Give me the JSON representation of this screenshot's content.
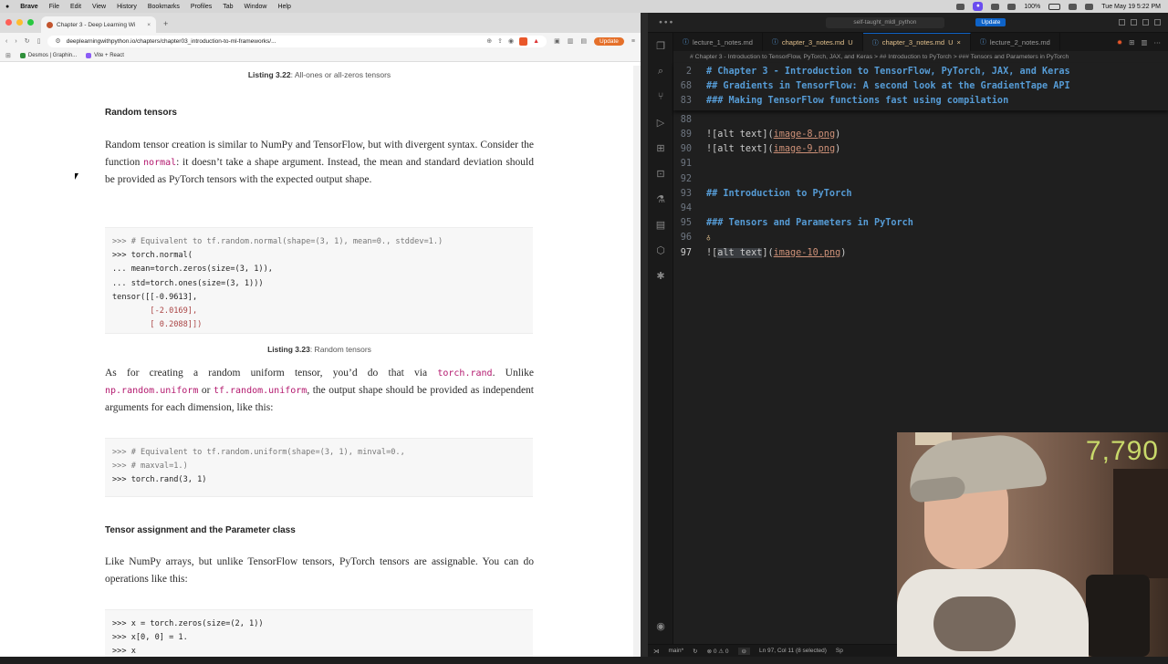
{
  "menubar": {
    "items": [
      "Brave",
      "File",
      "Edit",
      "View",
      "History",
      "Bookmarks",
      "Profiles",
      "Tab",
      "Window",
      "Help"
    ],
    "zoom": "100%",
    "datetime": "Tue May 19  5:22 PM"
  },
  "browser": {
    "tab_title": "Chapter 3 - Deep Learning Wi",
    "url": "deeplearningwithpython.io/chapters/chapter03_introduction-to-ml-frameworks/...",
    "update_label": "Update",
    "bookmarks": [
      "Desmos | Graphin...",
      "Vite + React"
    ],
    "page": {
      "caption_322": "Listing 3.22",
      "caption_322_text": ": All-ones or all-zeros tensors",
      "h_random": "Random tensors",
      "p1_a": "Random tensor creation is similar to NumPy and TensorFlow, but with divergent syntax. Consider the function ",
      "p1_code": "normal",
      "p1_b": ": it doesn’t take a shape argument. Instead, the mean and standard deviation should be provided as PyTorch tensors with the expected output shape.",
      "code1": [
        ">>> # Equivalent to tf.random.normal(shape=(3, 1), mean=0., stddev=1.)",
        ">>> torch.normal(",
        "... mean=torch.zeros(size=(3, 1)),",
        "... std=torch.ones(size=(3, 1)))",
        "tensor([[-0.9613],",
        "        [-2.0169],",
        "        [ 0.2088]])"
      ],
      "caption_323": "Listing 3.23",
      "caption_323_text": ": Random tensors",
      "p2_a": "As for creating a random uniform tensor, you’d do that via ",
      "p2_code1": "torch.rand",
      "p2_b": ". Unlike ",
      "p2_code2": "np.random.uniform",
      "p2_c": " or ",
      "p2_code3": "tf.random.uniform",
      "p2_d": ", the output shape should be provided as independent arguments for each dimension, like this:",
      "code2": [
        ">>> # Equivalent to tf.random.uniform(shape=(3, 1), minval=0.,",
        ">>> # maxval=1.)",
        ">>> torch.rand(3, 1)"
      ],
      "h_assign": "Tensor assignment and the Parameter class",
      "p3": "Like NumPy arrays, but unlike TensorFlow tensors, PyTorch tensors are assignable. You can do operations like this:",
      "code3": [
        ">>> x = torch.zeros(size=(2, 1))",
        ">>> x[0, 0] = 1.",
        ">>> x"
      ]
    }
  },
  "editor": {
    "workspace": "self-taught_mldl_python",
    "update_label": "Update",
    "tabs": [
      {
        "label": "lecture_1_notes.md",
        "mod": ""
      },
      {
        "label": "chapter_3_notes.md",
        "mod": "U"
      },
      {
        "label": "chapter_3_notes.md",
        "mod": "U"
      },
      {
        "label": "lecture_2_notes.md",
        "mod": ""
      }
    ],
    "breadcrumbs": "# Chapter 3 - Introduction to TensorFlow, PyTorch, JAX, and Keras  >  ## Introduction to PyTorch  >  ### Tensors and Parameters in PyTorch",
    "sticky": [
      {
        "n": "2",
        "t": "# Chapter 3 - Introduction to TensorFlow, PyTorch, JAX, and Keras"
      },
      {
        "n": "68",
        "t": "## Gradients in TensorFlow: A second look at the GradientTape API"
      },
      {
        "n": "83",
        "t": "### Making TensorFlow functions fast using compilation"
      }
    ],
    "lines": [
      {
        "n": "88",
        "t": ""
      },
      {
        "n": "89",
        "a": "![alt text](",
        "l": "image-8.png",
        "b": ")"
      },
      {
        "n": "90",
        "a": "![alt text](",
        "l": "image-9.png",
        "b": ")"
      },
      {
        "n": "91",
        "t": ""
      },
      {
        "n": "92",
        "t": ""
      },
      {
        "n": "93",
        "h": "## Introduction to PyTorch"
      },
      {
        "n": "94",
        "t": ""
      },
      {
        "n": "95",
        "h": "### Tensors and Parameters in PyTorch"
      },
      {
        "n": "96",
        "t": ""
      },
      {
        "n": "97",
        "a": "![",
        "s": "alt text",
        "a2": "](",
        "l": "image-10.png",
        "b": ")"
      }
    ],
    "status": {
      "branch": "main*",
      "problems": "⊗ 0 ⚠ 0",
      "position": "Ln 97, Col 11 (8 selected)",
      "extra": "Sp"
    }
  },
  "webcam": {
    "counter": "7,790"
  },
  "colors": {
    "accent": "#0e63c8",
    "brave": "#e9572a",
    "heading": "#569cd6",
    "link": "#ce9178",
    "inline_code": "#b3186e"
  }
}
